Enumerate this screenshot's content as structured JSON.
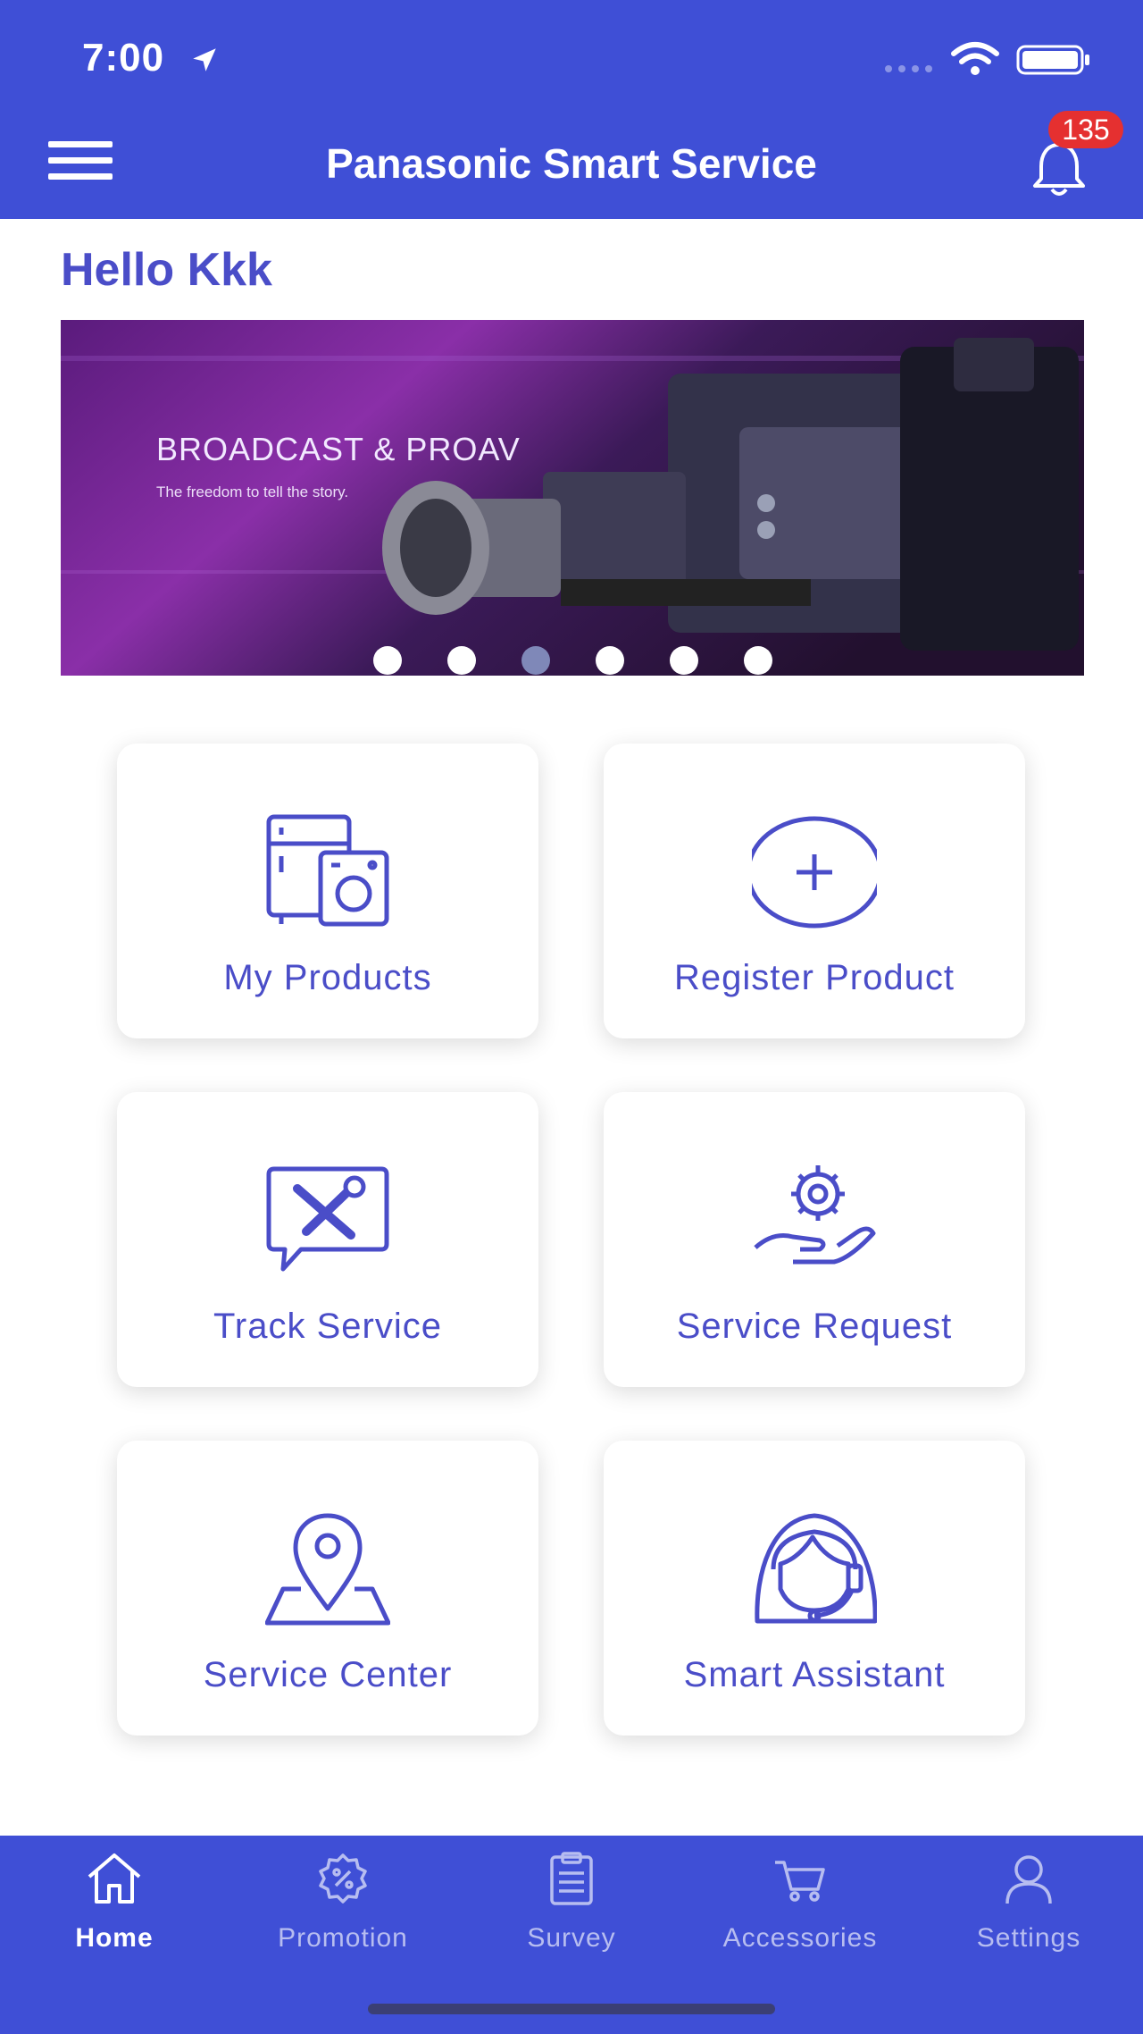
{
  "status_bar": {
    "time": "7:00",
    "location_icon": "location-arrow-icon",
    "wifi_icon": "wifi-icon",
    "battery_icon": "battery-icon"
  },
  "header": {
    "title": "Panasonic Smart Service",
    "menu_icon": "hamburger-menu-icon",
    "bell_icon": "bell-icon",
    "notification_count": "135"
  },
  "greeting": "Hello Kkk",
  "banner": {
    "title": "BROADCAST & PROAV",
    "subtitle": "The freedom to tell the story.",
    "slide_count": 6,
    "active_slide": 3
  },
  "tiles": [
    {
      "label": "My Products",
      "icon": "appliances-icon"
    },
    {
      "label": "Register Product",
      "icon": "plus-circle-icon"
    },
    {
      "label": "Track Service",
      "icon": "tools-chat-icon"
    },
    {
      "label": "Service Request",
      "icon": "gear-hand-icon"
    },
    {
      "label": "Service Center",
      "icon": "map-pin-icon"
    },
    {
      "label": "Smart Assistant",
      "icon": "headset-agent-icon"
    }
  ],
  "tabbar": {
    "active": "Home",
    "items": [
      {
        "label": "Home",
        "icon": "home-icon"
      },
      {
        "label": "Promotion",
        "icon": "promotion-badge-icon"
      },
      {
        "label": "Survey",
        "icon": "clipboard-icon"
      },
      {
        "label": "Accessories",
        "icon": "cart-icon"
      },
      {
        "label": "Settings",
        "icon": "user-icon"
      }
    ]
  },
  "colors": {
    "primary": "#3f4fd6",
    "accent": "#4a4dc8",
    "badge": "#e53030"
  }
}
